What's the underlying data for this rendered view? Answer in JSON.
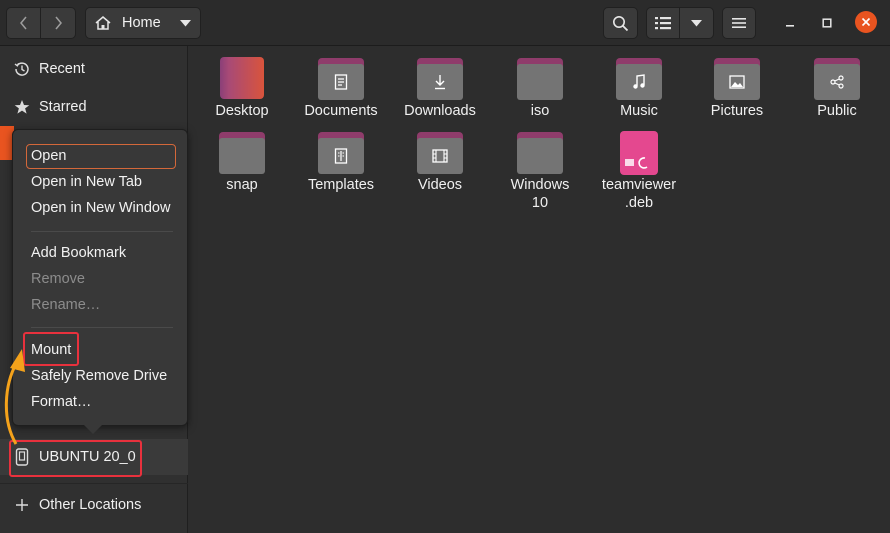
{
  "header": {
    "location_label": "Home",
    "icons": {
      "back": "chevron-left-icon",
      "forward": "chevron-right-icon",
      "home": "home-icon",
      "search": "search-icon",
      "list_view": "list-view-icon",
      "view_options": "chevron-down-icon",
      "menu": "hamburger-icon",
      "minimize": "minimize-icon",
      "maximize": "maximize-icon",
      "close": "close-icon"
    },
    "accent_color": "#e95420"
  },
  "sidebar": {
    "items": [
      {
        "label": "Recent",
        "icon": "clock-icon"
      },
      {
        "label": "Starred",
        "icon": "star-icon"
      }
    ],
    "drive": {
      "label": "UBUNTU 20_0",
      "icon": "usb-drive-icon"
    },
    "other": {
      "label": "Other Locations",
      "icon": "plus-icon"
    }
  },
  "context_menu": {
    "open": "Open",
    "open_new_tab": "Open in New Tab",
    "open_new_window": "Open in New Window",
    "add_bookmark": "Add Bookmark",
    "remove": "Remove",
    "rename": "Rename…",
    "mount": "Mount",
    "safely_remove": "Safely Remove Drive",
    "format": "Format…"
  },
  "files": [
    {
      "name": "Desktop",
      "kind": "desktop"
    },
    {
      "name": "Documents",
      "kind": "folder",
      "emblem": "document-icon"
    },
    {
      "name": "Downloads",
      "kind": "folder",
      "emblem": "download-icon"
    },
    {
      "name": "iso",
      "kind": "folder",
      "emblem": ""
    },
    {
      "name": "Music",
      "kind": "folder",
      "emblem": "music-note-icon"
    },
    {
      "name": "Pictures",
      "kind": "folder",
      "emblem": "picture-icon"
    },
    {
      "name": "Public",
      "kind": "folder",
      "emblem": "share-icon"
    },
    {
      "name": "snap",
      "kind": "folder",
      "emblem": ""
    },
    {
      "name": "Templates",
      "kind": "folder",
      "emblem": "template-icon"
    },
    {
      "name": "Videos",
      "kind": "folder",
      "emblem": "film-icon"
    },
    {
      "name": "Windows 10",
      "kind": "folder",
      "emblem": ""
    },
    {
      "name": "teamviewer .deb",
      "kind": "deb-package"
    }
  ],
  "colors": {
    "folder_tab": "#8f3c6b",
    "folder_body": "#747474",
    "annotation_red": "#e8313d",
    "annotation_arrow": "#f4a21b",
    "deb_pink": "#e4488f"
  }
}
